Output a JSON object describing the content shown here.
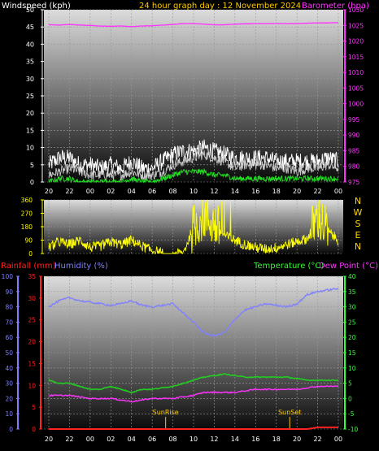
{
  "colors": {
    "wind": "#c8c8c8",
    "gust": "#ffffff",
    "windAvg": "#22dd22",
    "baro": "#ff33ff",
    "dir": "#ffff00",
    "dirText": "#ffd800",
    "rain": "#ff2222",
    "hum": "#8080ff",
    "temp": "#22cc22",
    "dew": "#ff33ff",
    "tempAxis": "#33ff33",
    "title": "#ffcc00",
    "sun": "#ffcc00"
  },
  "chart_data": [
    {
      "type": "line",
      "title": "24 hour graph day : 12 November 2024",
      "ylabel": "Windspeed (kph)",
      "y2label": "Barometer (hpa)",
      "categories": [
        "20",
        "22",
        "00",
        "02",
        "04",
        "06",
        "08",
        "10",
        "12",
        "14",
        "16",
        "18",
        "20",
        "22",
        "00"
      ],
      "x_hours": [
        0,
        2,
        4,
        6,
        8,
        10,
        12,
        14,
        16,
        18,
        20,
        22,
        24,
        26,
        28
      ],
      "ylim": [
        0,
        50
      ],
      "yticks": [
        "0",
        "5",
        "10",
        "15",
        "20",
        "25",
        "30",
        "35",
        "40",
        "45",
        "50"
      ],
      "y2lim": [
        975,
        1030
      ],
      "y2ticks": [
        "975",
        "980",
        "985",
        "990",
        "995",
        "1000",
        "1005",
        "1010",
        "1015",
        "1020",
        "1025",
        "1030"
      ],
      "series": [
        {
          "axis": "right",
          "x": [
            0,
            1,
            2,
            3,
            4,
            5,
            6,
            7,
            8,
            9,
            10,
            11,
            12,
            13,
            14,
            15,
            16,
            17,
            18,
            19,
            20,
            21,
            22,
            23,
            24,
            25,
            26,
            27,
            28
          ],
          "values": [
            1025.2,
            1025.1,
            1025.3,
            1025.1,
            1025.0,
            1024.8,
            1024.7,
            1024.8,
            1024.6,
            1024.8,
            1024.9,
            1025.1,
            1025.3,
            1025.6,
            1025.6,
            1025.4,
            1025.2,
            1025.2,
            1025.4,
            1025.5,
            1025.6,
            1025.6,
            1025.6,
            1025.6,
            1025.6,
            1025.7,
            1025.8,
            1025.8,
            1025.9
          ]
        },
        {
          "axis": "left",
          "x": [
            0,
            1,
            2,
            3,
            4,
            5,
            6,
            7,
            8,
            9,
            10,
            11,
            12,
            13,
            14,
            15,
            16,
            17,
            18,
            19,
            20,
            21,
            22,
            23,
            24,
            25,
            26,
            27,
            28
          ],
          "values": [
            2,
            3,
            4,
            3,
            2,
            2,
            2,
            2,
            3,
            2,
            2,
            3,
            5,
            6,
            7,
            8,
            7,
            6,
            4,
            5,
            5,
            5,
            4,
            4,
            3,
            4,
            4,
            5,
            4
          ]
        },
        {
          "axis": "left",
          "x": [
            0,
            1,
            2,
            3,
            4,
            5,
            6,
            7,
            8,
            9,
            10,
            11,
            12,
            13,
            14,
            15,
            16,
            17,
            18,
            19,
            20,
            21,
            22,
            23,
            24,
            25,
            26,
            27,
            28
          ],
          "values": [
            5,
            7,
            7,
            5,
            5,
            4,
            5,
            4,
            6,
            4,
            4,
            6,
            8,
            9,
            9,
            10,
            9,
            8,
            7,
            7,
            7,
            7,
            6,
            6,
            6,
            6,
            6,
            7,
            6
          ]
        },
        {
          "axis": "left",
          "x": [
            0,
            1,
            2,
            3,
            4,
            5,
            6,
            7,
            8,
            9,
            10,
            11,
            12,
            13,
            14,
            15,
            16,
            17,
            18,
            19,
            20,
            21,
            22,
            23,
            24,
            25,
            26,
            27,
            28
          ],
          "values": [
            0,
            1,
            1,
            0,
            0,
            0,
            0,
            0,
            1,
            0,
            0,
            1,
            2,
            3,
            3,
            3,
            2,
            2,
            1,
            1,
            1,
            1,
            1,
            1,
            1,
            1,
            1,
            1,
            1
          ]
        }
      ]
    },
    {
      "type": "line",
      "ylabel": "",
      "categories": [
        "20",
        "22",
        "00",
        "02",
        "04",
        "06",
        "08",
        "10",
        "12",
        "14",
        "16",
        "18",
        "20",
        "22",
        "00"
      ],
      "ylim": [
        0,
        360
      ],
      "yticks": [
        "0",
        "90",
        "180",
        "270",
        "360"
      ],
      "compass": [
        "N",
        "W",
        "S",
        "E",
        "N"
      ],
      "series": [
        {
          "x": [
            0,
            1,
            2,
            3,
            4,
            5,
            6,
            7,
            8,
            9,
            10,
            11,
            12,
            13,
            14,
            15,
            16,
            17,
            18,
            19,
            20,
            21,
            22,
            23,
            24,
            25,
            26,
            27,
            28
          ],
          "values": [
            40,
            80,
            60,
            90,
            40,
            50,
            80,
            60,
            90,
            50,
            20,
            0,
            0,
            0,
            180,
            250,
            200,
            120,
            90,
            60,
            40,
            30,
            40,
            60,
            80,
            100,
            250,
            150,
            90
          ]
        }
      ]
    },
    {
      "type": "line",
      "ylabel": "Rainfall (mm)",
      "y2label": "Humidity (%)",
      "y3label": "Temperature (°C)",
      "y4label": "Dew Point (°C)",
      "categories": [
        "20",
        "22",
        "00",
        "02",
        "04",
        "06",
        "08",
        "10",
        "12",
        "14",
        "16",
        "18",
        "20",
        "22",
        "00"
      ],
      "humidity_lim": [
        0,
        100
      ],
      "humidity_ticks": [
        "0",
        "10",
        "20",
        "30",
        "40",
        "50",
        "60",
        "70",
        "80",
        "90",
        "100"
      ],
      "rain_lim": [
        0,
        35
      ],
      "rain_ticks": [
        "0",
        "5",
        "10",
        "15",
        "20",
        "25",
        "30",
        "35"
      ],
      "temp_lim": [
        -10,
        40
      ],
      "temp_ticks": [
        "-10",
        "-5",
        "0",
        "5",
        "10",
        "15",
        "20",
        "25",
        "30",
        "35",
        "40"
      ],
      "annotations": [
        {
          "text": "SunRise",
          "x": 11.3
        },
        {
          "text": "SunSet",
          "x": 23.3
        }
      ],
      "series": [
        {
          "name": "Humidity (%)",
          "x": [
            0,
            1,
            2,
            3,
            4,
            5,
            6,
            7,
            8,
            9,
            10,
            11,
            12,
            13,
            14,
            15,
            16,
            17,
            18,
            19,
            20,
            21,
            22,
            23,
            24,
            25,
            26,
            27,
            28
          ],
          "values": [
            80,
            84,
            86,
            84,
            83,
            82,
            81,
            82,
            84,
            81,
            80,
            81,
            82,
            76,
            70,
            63,
            61,
            63,
            72,
            78,
            80,
            82,
            81,
            80,
            82,
            88,
            90,
            91,
            92
          ]
        },
        {
          "name": "Temperature (°C)",
          "x": [
            0,
            1,
            2,
            3,
            4,
            5,
            6,
            7,
            8,
            9,
            10,
            11,
            12,
            13,
            14,
            15,
            16,
            17,
            18,
            19,
            20,
            21,
            22,
            23,
            24,
            25,
            26,
            27,
            28
          ],
          "values": [
            6,
            5,
            5,
            4,
            3,
            3,
            4,
            3,
            2,
            3,
            3,
            3.5,
            4,
            5,
            6,
            7,
            7.5,
            8,
            7.5,
            7,
            7,
            7,
            7,
            7,
            6.5,
            6,
            6,
            6,
            6
          ]
        },
        {
          "name": "Dew Point (°C)",
          "x": [
            0,
            1,
            2,
            3,
            4,
            5,
            6,
            7,
            8,
            9,
            10,
            11,
            12,
            13,
            14,
            15,
            16,
            17,
            18,
            19,
            20,
            21,
            22,
            23,
            24,
            25,
            26,
            27,
            28
          ],
          "values": [
            1,
            1,
            1,
            0.5,
            0,
            0,
            0,
            -0.5,
            -1,
            -0.5,
            0,
            0,
            0,
            0.5,
            1,
            2,
            2,
            2,
            2,
            2.5,
            3,
            3,
            3,
            3,
            3,
            3.5,
            4,
            4,
            4
          ]
        },
        {
          "name": "Rainfall (mm)",
          "x": [
            0,
            1,
            2,
            3,
            4,
            5,
            6,
            7,
            8,
            9,
            10,
            11,
            12,
            13,
            14,
            15,
            16,
            17,
            18,
            19,
            20,
            21,
            22,
            23,
            24,
            25,
            26,
            27,
            28
          ],
          "values": [
            0,
            0,
            0,
            0,
            0,
            0,
            0,
            0,
            0,
            0,
            0,
            0,
            0,
            0,
            0,
            0,
            0,
            0,
            0,
            0,
            0,
            0,
            0,
            0,
            0,
            0,
            0.4,
            0.4,
            0.4
          ]
        }
      ]
    }
  ]
}
